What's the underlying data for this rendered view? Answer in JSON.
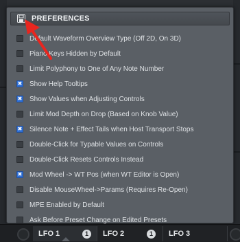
{
  "panel": {
    "title": "PREFERENCES",
    "icon": "save-icon"
  },
  "preferences": [
    {
      "label": "Default Waveform Overview Type (Off 2D, On 3D)",
      "checked": false
    },
    {
      "label": "Piano Keys Hidden by Default",
      "checked": false
    },
    {
      "label": "Limit Polyphony to One of Any Note Number",
      "checked": false
    },
    {
      "label": "Show Help Tooltips",
      "checked": true
    },
    {
      "label": "Show Values when Adjusting Controls",
      "checked": true
    },
    {
      "label": "Limit Mod Depth on Drop (Based on Knob Value)",
      "checked": false
    },
    {
      "label": "Silence Note + Effect Tails when Host Transport Stops",
      "checked": true
    },
    {
      "label": "Double-Click for Typable Values on Controls",
      "checked": false
    },
    {
      "label": "Double-Click Resets Controls Instead",
      "checked": false
    },
    {
      "label": "Mod Wheel -> WT Pos (when WT Editor is Open)",
      "checked": true
    },
    {
      "label": "Disable MouseWheel->Params (Requires Re-Open)",
      "checked": false
    },
    {
      "label": "MPE Enabled by Default",
      "checked": false
    },
    {
      "label": "Ask Before Preset Change on Edited Presets",
      "checked": false
    }
  ],
  "lfo_tabs": [
    {
      "label": "LFO 1",
      "badge": "1",
      "active": true
    },
    {
      "label": "LFO 2",
      "badge": "1",
      "active": false
    },
    {
      "label": "LFO 3",
      "badge": "",
      "active": false
    }
  ],
  "colors": {
    "accent": "#2f6fd4",
    "annotation_arrow": "#e8261f",
    "panel_bg": "#5a5f65"
  }
}
